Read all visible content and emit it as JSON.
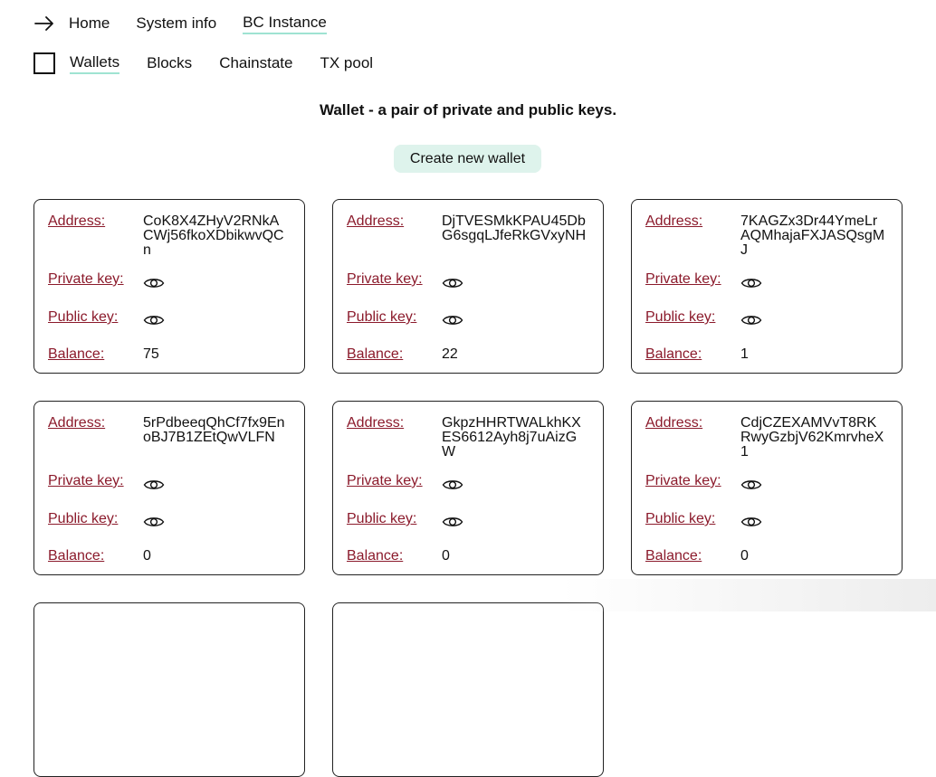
{
  "nav": {
    "back_icon": "arrow-right-icon",
    "links": [
      "Home",
      "System info",
      "BC Instance"
    ],
    "active": "BC Instance"
  },
  "subnav": {
    "links": [
      "Wallets",
      "Blocks",
      "Chainstate",
      "TX pool"
    ],
    "active": "Wallets"
  },
  "page": {
    "title": "Wallet - a pair of private and public keys.",
    "create_button": "Create new wallet"
  },
  "labels": {
    "address": "Address:",
    "private_key": "Private key:",
    "public_key": "Public key:",
    "balance": "Balance:"
  },
  "icons": {
    "reveal": "eye-icon"
  },
  "colors": {
    "label": "#8b1a2b",
    "accent": "#9fe3d2",
    "button_bg": "#def3ec"
  },
  "wallets": [
    {
      "address": "CoK8X4ZHyV2RNkACWj56fkoXDbikwvQCn",
      "balance": "75"
    },
    {
      "address": "DjTVESMkKPAU45DbG6sgqLJfeRkGVxyNH",
      "balance": "22"
    },
    {
      "address": "7KAGZx3Dr44YmeLrAQMhajaFXJASQsgMJ",
      "balance": "1"
    },
    {
      "address": "5rPdbeeqQhCf7fx9EnoBJ7B1ZEtQwVLFN",
      "balance": "0"
    },
    {
      "address": "GkpzHHRTWALkhKXES6612Ayh8j7uAizGW",
      "balance": "0"
    },
    {
      "address": "CdjCZEXAMVvT8RKRwyGzbjV62KmrvheX1",
      "balance": "0"
    }
  ]
}
